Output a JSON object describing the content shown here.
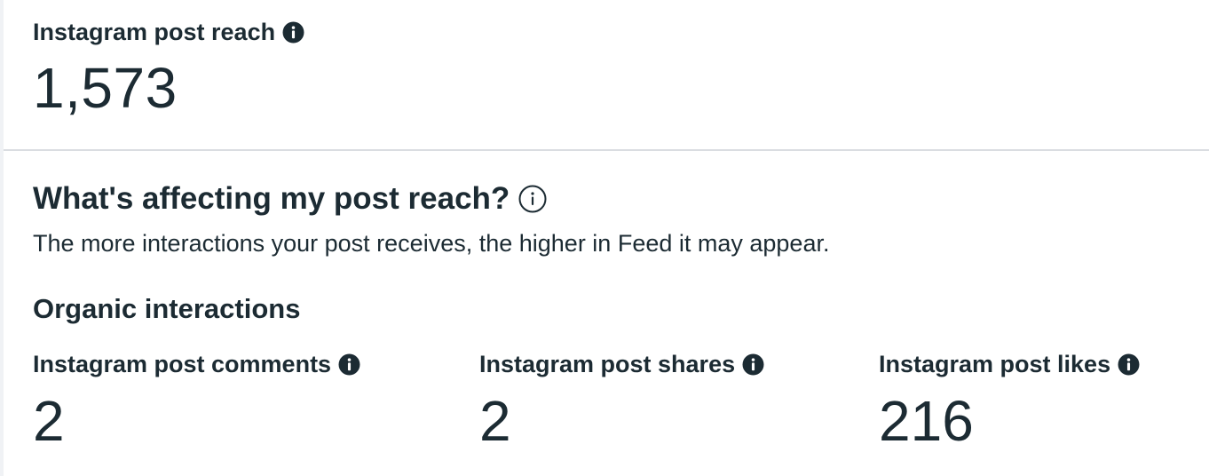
{
  "reach": {
    "label": "Instagram post reach",
    "value": "1,573",
    "info_icon": "info-filled-icon"
  },
  "affecting": {
    "title": "What's affecting my post reach?",
    "description": "The more interactions your post receives, the higher in Feed it may appear.",
    "info_icon": "info-outline-icon"
  },
  "organic": {
    "title": "Organic interactions",
    "metrics": [
      {
        "label": "Instagram post comments",
        "value": "2",
        "info_icon": "info-filled-icon"
      },
      {
        "label": "Instagram post shares",
        "value": "2",
        "info_icon": "info-filled-icon"
      },
      {
        "label": "Instagram post likes",
        "value": "216",
        "info_icon": "info-filled-icon"
      }
    ]
  },
  "colors": {
    "text": "#1c2b33",
    "divider": "#dadde1",
    "background": "#ffffff"
  }
}
